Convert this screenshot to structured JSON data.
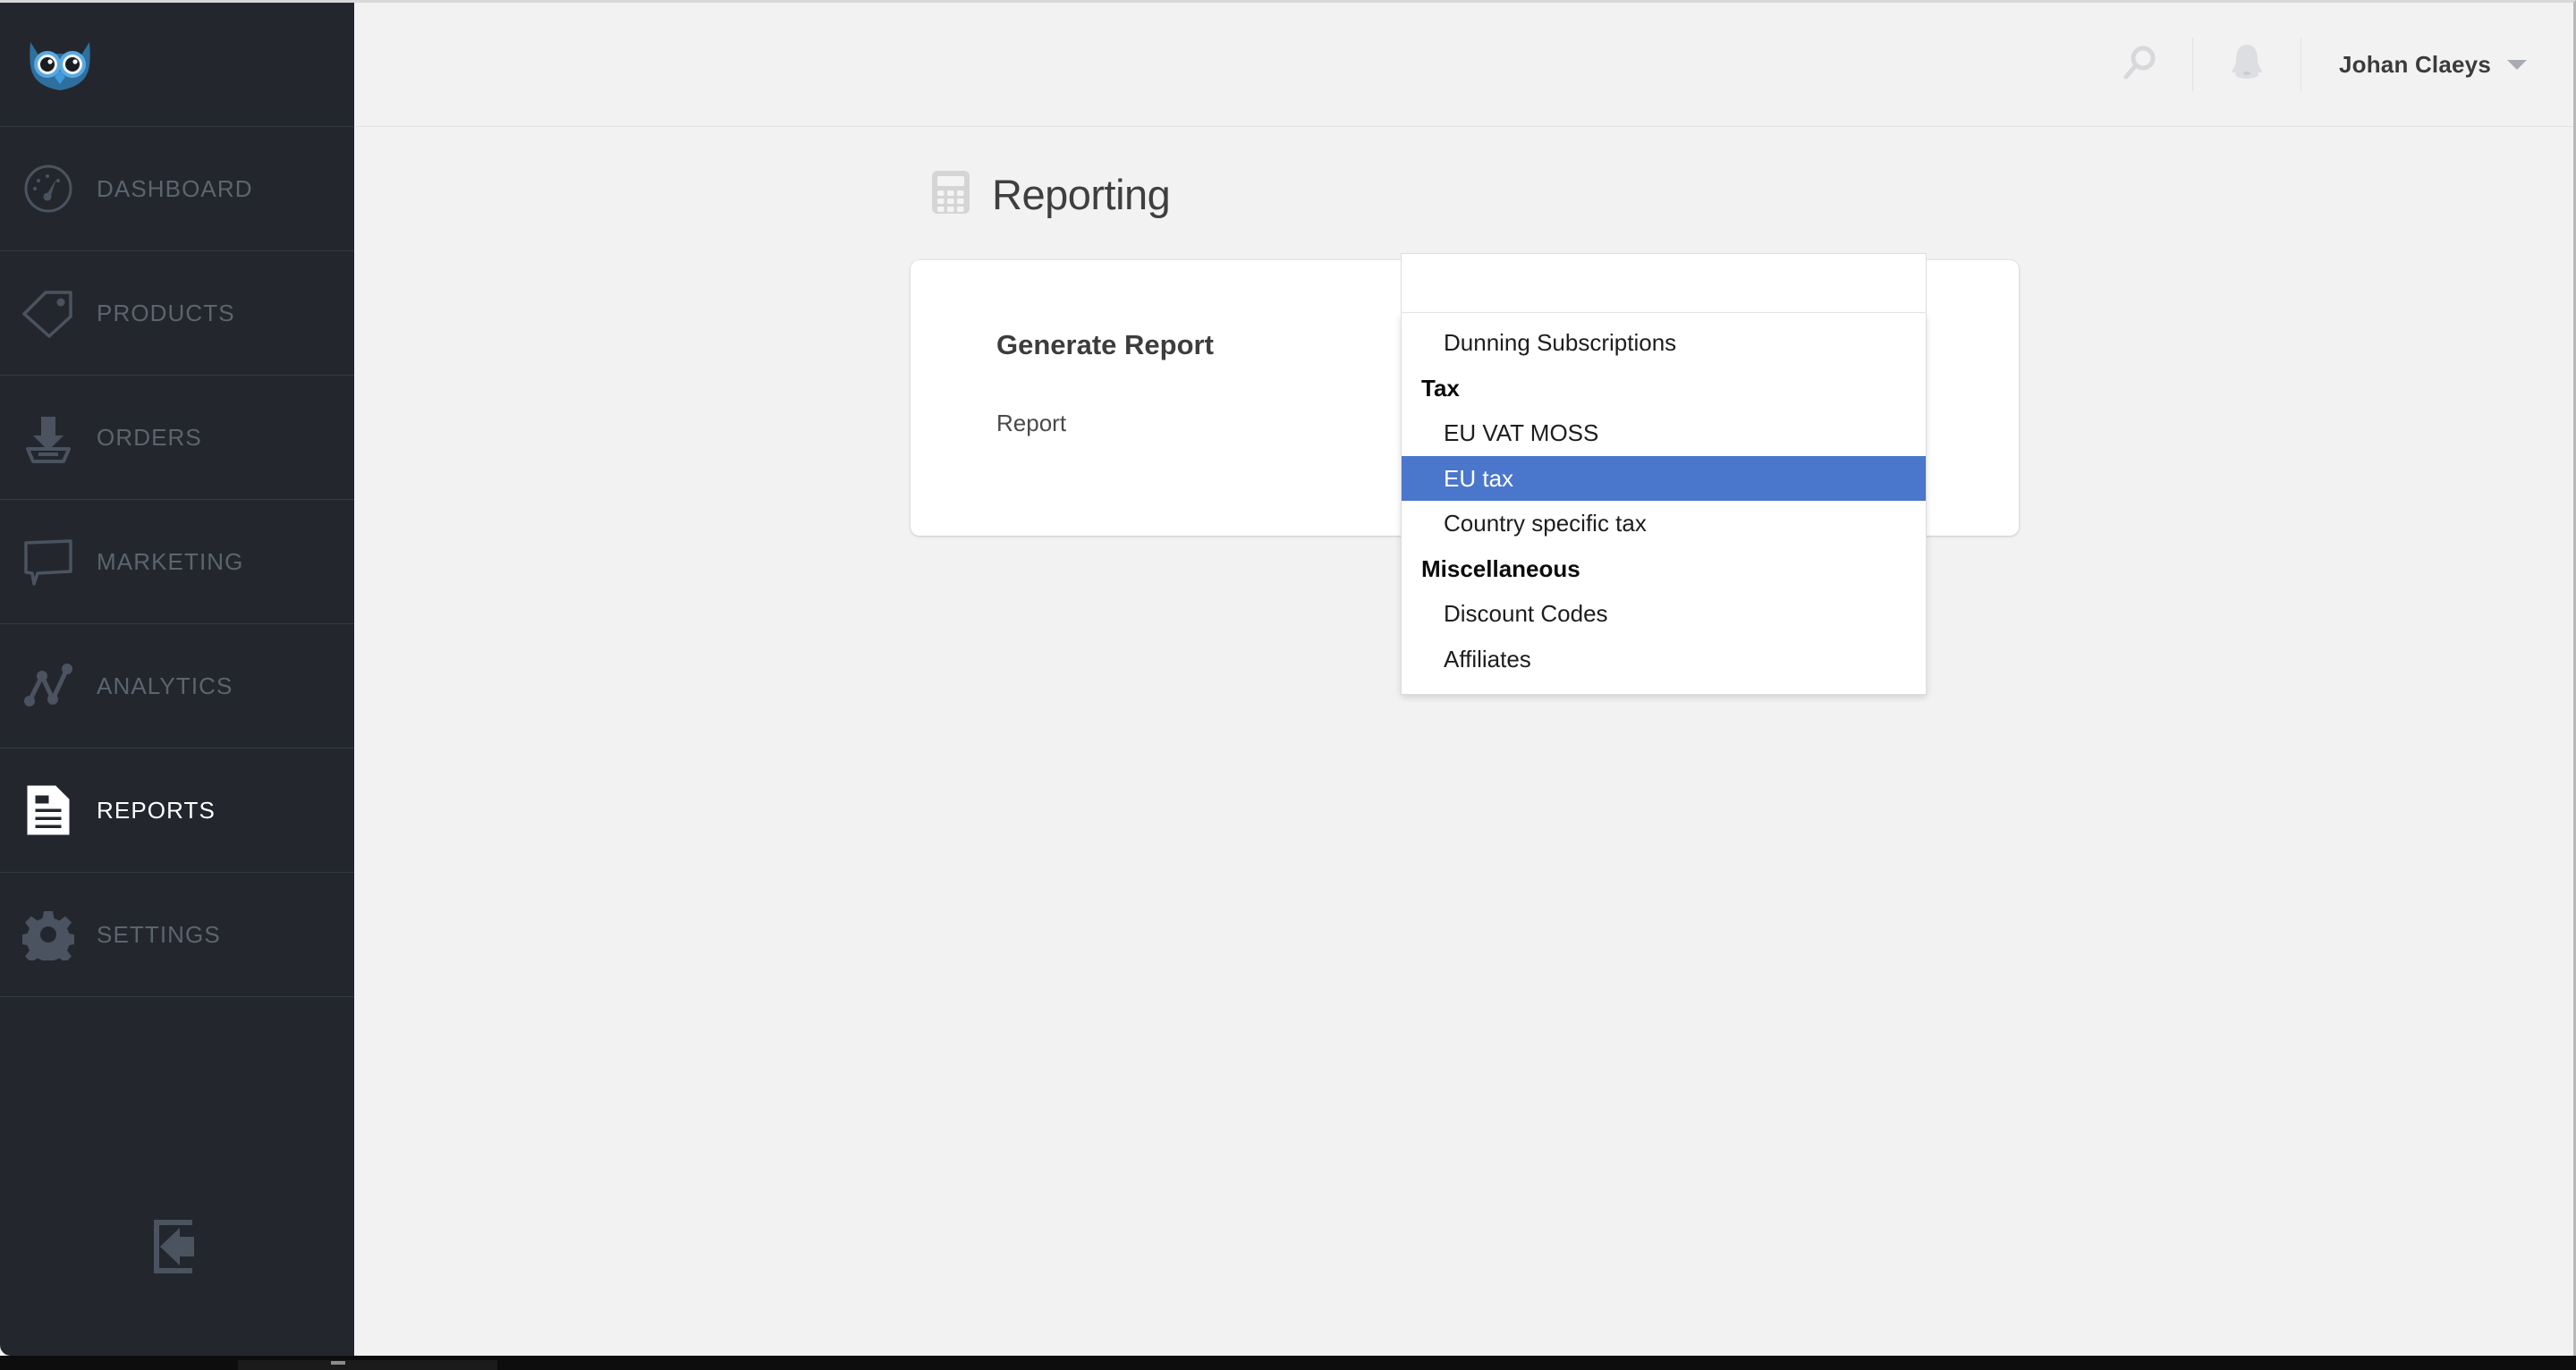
{
  "brand": {
    "logo_icon": "owl-logo"
  },
  "sidebar": {
    "items": [
      {
        "label": "DASHBOARD",
        "icon": "gauge-icon",
        "active": false
      },
      {
        "label": "PRODUCTS",
        "icon": "tag-icon",
        "active": false
      },
      {
        "label": "ORDERS",
        "icon": "inbox-download-icon",
        "active": false
      },
      {
        "label": "MARKETING",
        "icon": "speech-bubble-icon",
        "active": false
      },
      {
        "label": "ANALYTICS",
        "icon": "line-chart-icon",
        "active": false
      },
      {
        "label": "REPORTS",
        "icon": "document-lines-icon",
        "active": true
      },
      {
        "label": "SETTINGS",
        "icon": "gear-icon",
        "active": false
      }
    ],
    "logout_icon": "logout-arrow-icon"
  },
  "topbar": {
    "search_icon": "search-icon",
    "notifications_icon": "bell-icon",
    "user_name": "Johan Claeys",
    "user_caret_icon": "chevron-down-icon"
  },
  "page": {
    "title": "Reporting",
    "title_icon": "calculator-icon"
  },
  "card": {
    "title": "Generate Report",
    "field_label": "Report"
  },
  "select": {
    "value": "",
    "placeholder": "",
    "open": true,
    "selected_option": "EU tax",
    "highlight_color": "#4a76cc",
    "options": [
      {
        "label": "Dunning Subscriptions",
        "group": false,
        "selected": false
      },
      {
        "label": "Tax",
        "group": true,
        "selected": false
      },
      {
        "label": "EU VAT MOSS",
        "group": false,
        "selected": false
      },
      {
        "label": "EU tax",
        "group": false,
        "selected": true
      },
      {
        "label": "Country specific tax",
        "group": false,
        "selected": false
      },
      {
        "label": "Miscellaneous",
        "group": true,
        "selected": false
      },
      {
        "label": "Discount Codes",
        "group": false,
        "selected": false
      },
      {
        "label": "Affiliates",
        "group": false,
        "selected": false
      }
    ]
  }
}
